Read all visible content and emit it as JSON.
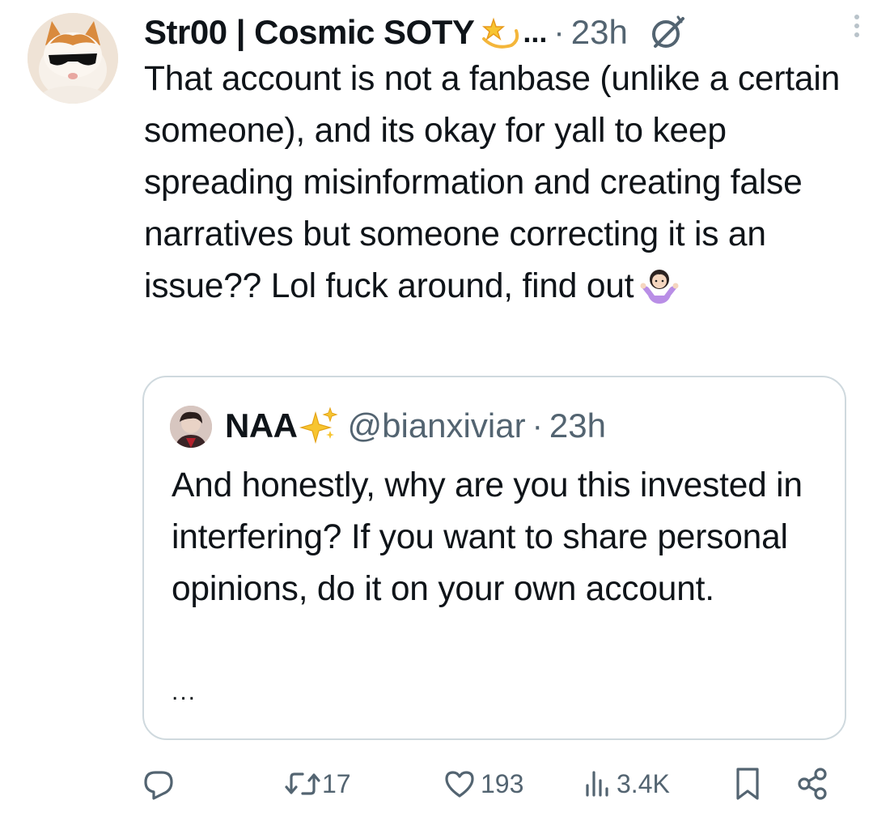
{
  "author": {
    "display_name": "Str00 | Cosmic SOTY",
    "name_emoji": "dizzy-star-emoji",
    "truncation": "...",
    "separator": "·",
    "time": "23h"
  },
  "tweet": {
    "text": "That account is not a fanbase (unlike a certain someone), and its okay for yall to keep spreading misinformation and creating false narratives but someone correcting it is an issue?? Lol fuck around, find out",
    "trailing_emoji": "woman-shrugging-emoji"
  },
  "quote": {
    "display_name": "NAA",
    "name_emoji": "sparkles-emoji",
    "handle": "@bianxiviar",
    "separator": "·",
    "time": "23h",
    "text": "And honestly, why are you this invested in interfering? If you want to share personal opinions, do it on your own account.",
    "more": "..."
  },
  "actions": {
    "replies": "",
    "reposts": "17",
    "likes": "193",
    "views": "3.4K"
  },
  "colors": {
    "text": "#0f1419",
    "muted": "#536471",
    "border": "#cfd9de"
  }
}
